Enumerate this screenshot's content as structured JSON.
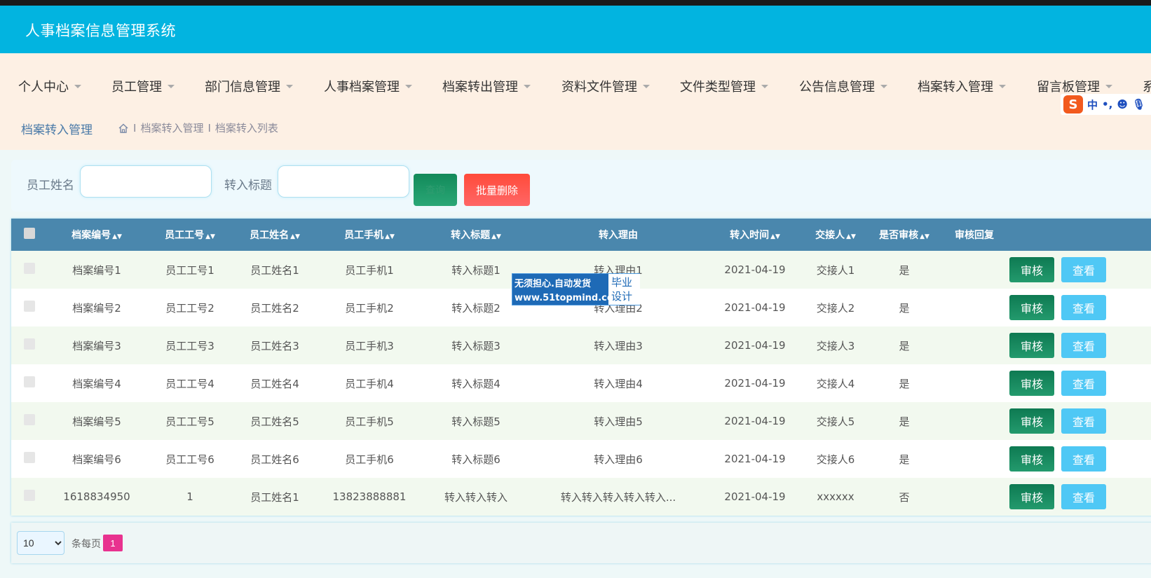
{
  "app": {
    "title": "人事档案信息管理系统"
  },
  "nav": {
    "items": [
      {
        "label": "个人中心"
      },
      {
        "label": "员工管理"
      },
      {
        "label": "部门信息管理"
      },
      {
        "label": "人事档案管理"
      },
      {
        "label": "档案转出管理"
      },
      {
        "label": "资料文件管理"
      },
      {
        "label": "文件类型管理"
      },
      {
        "label": "公告信息管理"
      },
      {
        "label": "档案转入管理"
      },
      {
        "label": "留言板管理"
      },
      {
        "label": "系"
      }
    ]
  },
  "breadcrumb": {
    "title": "档案转入管理",
    "separator": "I",
    "path": [
      "档案转入管理",
      "档案转入列表"
    ]
  },
  "ime": {
    "s": "S",
    "mode": "中",
    "punct": "•,",
    "emoji": "☻",
    "mic": "🎙"
  },
  "filter": {
    "name_label": "员工姓名",
    "name_value": "",
    "title_label": "转入标题",
    "title_value": "",
    "search_label": "查询",
    "batch_delete_label": "批量删除"
  },
  "table": {
    "headers": [
      "档案编号",
      "员工工号",
      "员工姓名",
      "员工手机",
      "转入标题",
      "转入理由",
      "转入时间",
      "交接人",
      "是否审核",
      "审核回复"
    ],
    "sortable": [
      true,
      true,
      true,
      true,
      true,
      false,
      true,
      true,
      true,
      false
    ],
    "rows": [
      [
        "档案编号1",
        "员工工号1",
        "员工姓名1",
        "员工手机1",
        "转入标题1",
        "转入理由1",
        "2021-04-19",
        "交接人1",
        "是",
        ""
      ],
      [
        "档案编号2",
        "员工工号2",
        "员工姓名2",
        "员工手机2",
        "转入标题2",
        "转入理由2",
        "2021-04-19",
        "交接人2",
        "是",
        ""
      ],
      [
        "档案编号3",
        "员工工号3",
        "员工姓名3",
        "员工手机3",
        "转入标题3",
        "转入理由3",
        "2021-04-19",
        "交接人3",
        "是",
        ""
      ],
      [
        "档案编号4",
        "员工工号4",
        "员工姓名4",
        "员工手机4",
        "转入标题4",
        "转入理由4",
        "2021-04-19",
        "交接人4",
        "是",
        ""
      ],
      [
        "档案编号5",
        "员工工号5",
        "员工姓名5",
        "员工手机5",
        "转入标题5",
        "转入理由5",
        "2021-04-19",
        "交接人5",
        "是",
        ""
      ],
      [
        "档案编号6",
        "员工工号6",
        "员工姓名6",
        "员工手机6",
        "转入标题6",
        "转入理由6",
        "2021-04-19",
        "交接人6",
        "是",
        ""
      ],
      [
        "1618834950",
        "1",
        "员工姓名1",
        "13823888881",
        "转入转入转入",
        "转入转入转入转入转入...",
        "2021-04-19",
        "xxxxxx",
        "否",
        ""
      ]
    ],
    "audit_label": "审核",
    "view_label": "查看"
  },
  "pager": {
    "page_size": "10",
    "page_size_options": [
      "10"
    ],
    "per_page_label": "条每页",
    "current_page": "1"
  },
  "watermark": {
    "line1": "无须担心.自动发货",
    "line2": "www.51topmind.com",
    "badge1": "毕业",
    "badge2": "设计"
  }
}
